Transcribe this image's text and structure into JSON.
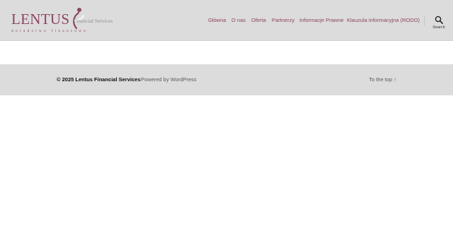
{
  "header": {
    "logo": {
      "name": "LENTUS",
      "subtitle": "Financial Services",
      "tagline": "doradztwo finansowe"
    },
    "nav": [
      {
        "label": "Główna"
      },
      {
        "label": "O nas"
      },
      {
        "label": "Oferta"
      },
      {
        "label": "Partnerzy"
      },
      {
        "label": "Informacje Prawne"
      },
      {
        "label": "Klauzula informacyjna (RODO)"
      }
    ],
    "search": {
      "label": "Search",
      "icon": "search-icon"
    }
  },
  "footer": {
    "copyright": "© 2025 Lentus Financial Services",
    "powered_by": "Powered by WordPress",
    "to_top": "To the top ↑"
  },
  "colors": {
    "accent": "#8c4462",
    "header_bg": "#dcdcdc",
    "footer_bg": "#dcdcdc",
    "page_bg": "#ffffff"
  }
}
